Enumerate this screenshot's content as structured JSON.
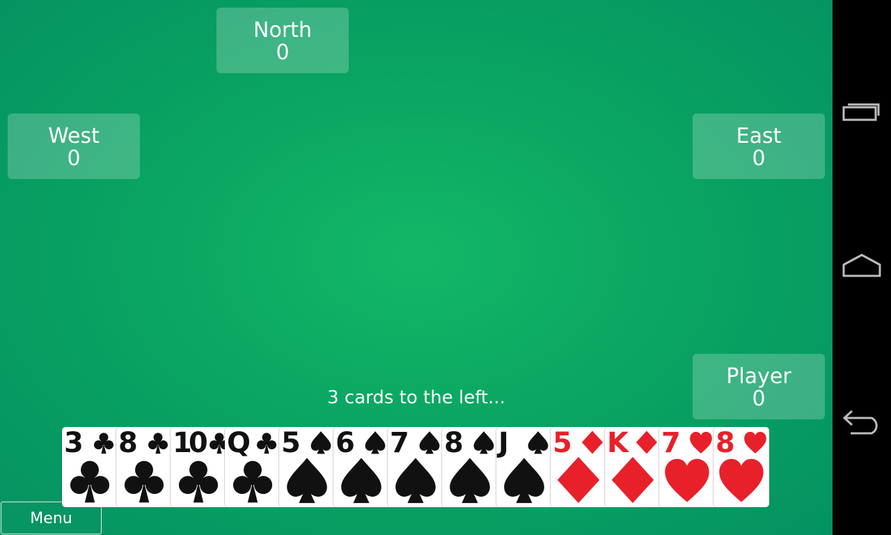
{
  "seats": {
    "north": {
      "name": "North",
      "score": "0"
    },
    "west": {
      "name": "West",
      "score": "0"
    },
    "east": {
      "name": "East",
      "score": "0"
    },
    "player": {
      "name": "Player",
      "score": "0"
    }
  },
  "status": "3 cards to the left...",
  "hand": [
    {
      "rank": "3",
      "suit": "clubs"
    },
    {
      "rank": "8",
      "suit": "clubs"
    },
    {
      "rank": "10",
      "suit": "clubs"
    },
    {
      "rank": "Q",
      "suit": "clubs"
    },
    {
      "rank": "5",
      "suit": "spades"
    },
    {
      "rank": "6",
      "suit": "spades"
    },
    {
      "rank": "7",
      "suit": "spades"
    },
    {
      "rank": "8",
      "suit": "spades"
    },
    {
      "rank": "J",
      "suit": "spades"
    },
    {
      "rank": "5",
      "suit": "diamonds"
    },
    {
      "rank": "K",
      "suit": "diamonds"
    },
    {
      "rank": "7",
      "suit": "hearts"
    },
    {
      "rank": "8",
      "suit": "hearts"
    }
  ],
  "menu_label": "Menu",
  "colors": {
    "felt": "#0aa562",
    "red_suit": "#e8202a",
    "black_suit": "#111111"
  },
  "nav_icons": [
    "recent-apps-icon",
    "home-icon",
    "back-icon"
  ]
}
